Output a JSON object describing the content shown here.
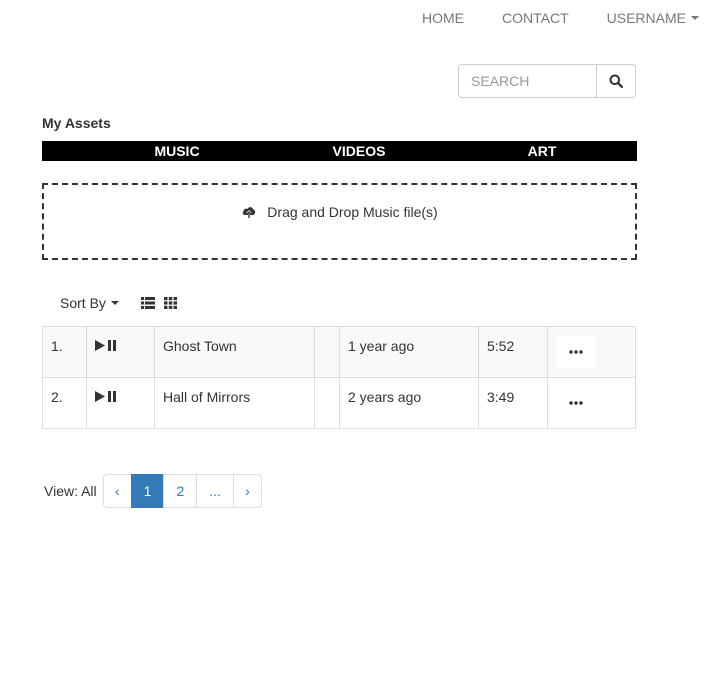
{
  "nav": {
    "home": "HOME",
    "contact": "CONTACT",
    "username": "USERNAME"
  },
  "search": {
    "placeholder": "SEARCH",
    "icon": "search-icon"
  },
  "assets": {
    "title": "My Assets",
    "tabs": [
      "MUSIC",
      "VIDEOS",
      "ART"
    ]
  },
  "dropzone": {
    "icon": "cloud-upload-icon",
    "text": "Drag and Drop Music file(s)"
  },
  "toolbar": {
    "sort_label": "Sort By",
    "view_icons": [
      "list-view-icon",
      "grid-view-icon"
    ]
  },
  "tracks": [
    {
      "num": "1.",
      "title": "Ghost Town",
      "extra": "",
      "added": "1 year ago",
      "duration": "5:52",
      "more": "•••"
    },
    {
      "num": "2.",
      "title": "Hall of Mirrors",
      "extra": "",
      "added": "2 years ago",
      "duration": "3:49",
      "more": "•••"
    }
  ],
  "pagination": {
    "view_label": "View: All",
    "prev": "‹",
    "pages": [
      "1",
      "2",
      "..."
    ],
    "next": "›",
    "active_page": "1"
  },
  "colors": {
    "accent": "#337ab7",
    "tab_bar": "#000000",
    "nav_text": "#777777"
  }
}
